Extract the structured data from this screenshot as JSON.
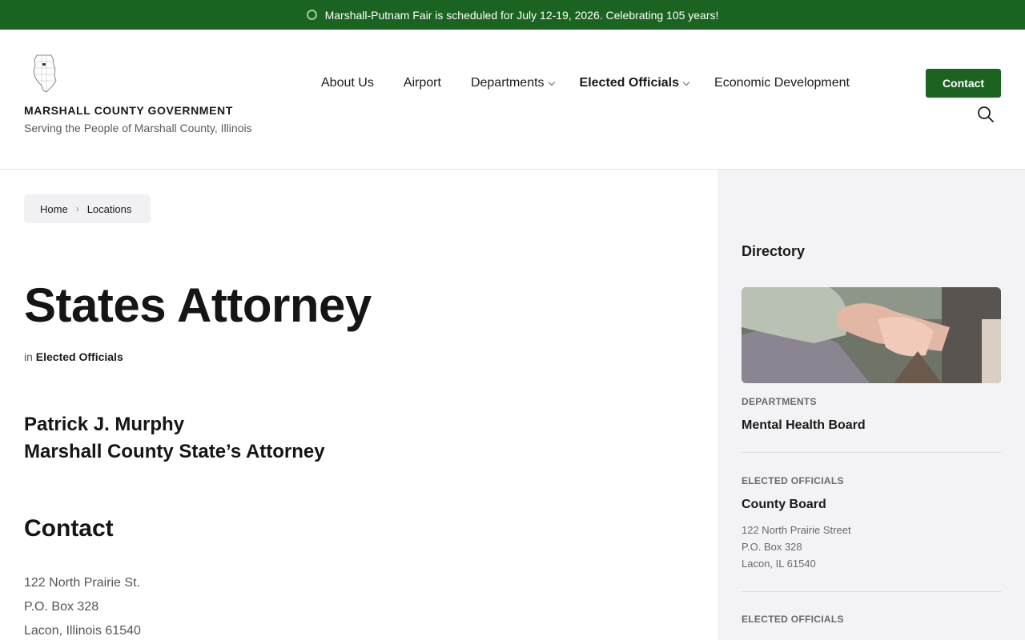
{
  "announcement": {
    "text": "Marshall-Putnam Fair is scheduled for July 12-19, 2026. Celebrating 105 years!"
  },
  "site": {
    "title": "MARSHALL COUNTY GOVERNMENT",
    "tagline": "Serving the People of Marshall County, Illinois",
    "logo_icon": "illinois-map-icon"
  },
  "nav": {
    "items": [
      {
        "label": "About Us",
        "dropdown": false
      },
      {
        "label": "Airport",
        "dropdown": false
      },
      {
        "label": "Departments",
        "dropdown": true
      },
      {
        "label": "Elected Officials",
        "dropdown": true,
        "active": true
      },
      {
        "label": "Economic Development",
        "dropdown": false
      }
    ],
    "contact_label": "Contact",
    "search_icon": "search-icon"
  },
  "breadcrumb": {
    "home": "Home",
    "current": "Locations"
  },
  "page": {
    "title": "States Attorney",
    "category_prefix": "in",
    "category": "Elected Officials",
    "person_name": "Patrick J. Murphy",
    "person_title": "Marshall County State’s Attorney",
    "contact_heading": "Contact",
    "address": [
      "122 North Prairie St.",
      "P.O. Box 328",
      "Lacon, Illinois 61540"
    ]
  },
  "sidebar": {
    "title": "Directory",
    "entries": [
      {
        "category": "DEPARTMENTS",
        "name": "Mental Health Board",
        "address": []
      },
      {
        "category": "ELECTED OFFICIALS",
        "name": "County Board",
        "address": [
          "122 North Prairie Street",
          "P.O. Box 328",
          "Lacon, IL 61540"
        ]
      },
      {
        "category": "ELECTED OFFICIALS",
        "name": "",
        "address": []
      }
    ]
  },
  "colors": {
    "brand_green": "#1b6321",
    "sidebar_bg": "#f3f3f5",
    "text": "#1a1a1a",
    "muted": "#6a6a6a"
  }
}
